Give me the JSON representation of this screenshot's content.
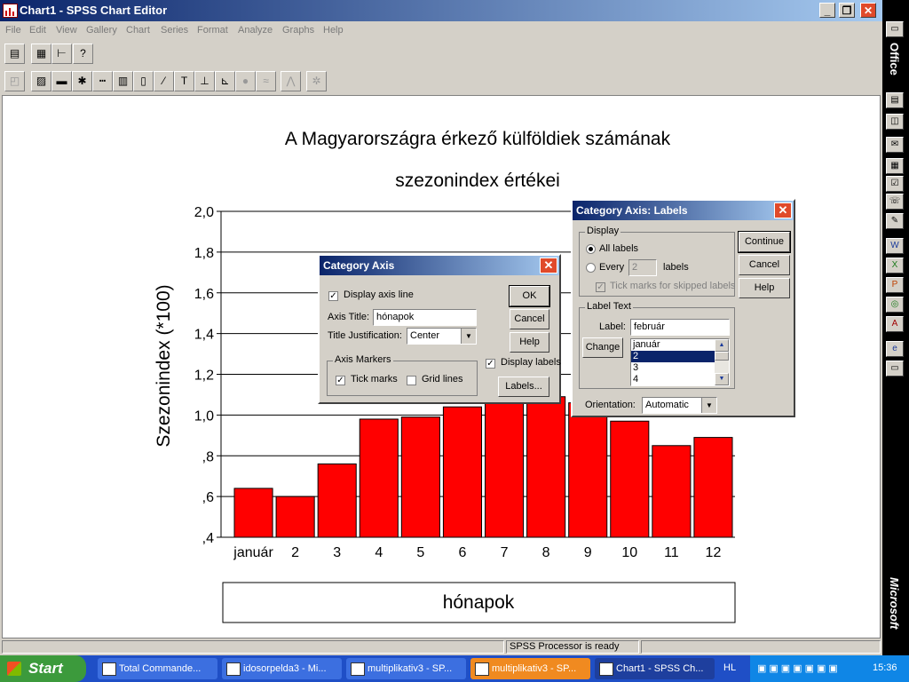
{
  "window": {
    "title": "Chart1 - SPSS Chart Editor"
  },
  "menus": [
    "File",
    "Edit",
    "View",
    "Gallery",
    "Chart",
    "Series",
    "Format",
    "Analyze",
    "Graphs",
    "Help"
  ],
  "status": {
    "message": "SPSS Processor  is ready"
  },
  "chart_data": {
    "type": "bar",
    "title": "A Magyarországra érkező külföldiek számának",
    "subtitle": "szezonindex értékei",
    "xlabel": "hónapok",
    "ylabel": "Szezonindex (*100)",
    "categories": [
      "január",
      "2",
      "3",
      "4",
      "5",
      "6",
      "7",
      "8",
      "9",
      "10",
      "11",
      "12"
    ],
    "values": [
      0.64,
      0.6,
      0.76,
      0.98,
      0.99,
      1.04,
      1.06,
      1.09,
      1.06,
      0.97,
      0.85,
      0.89
    ],
    "yticks": [
      "2,0",
      "1,8",
      "1,6",
      "1,4",
      "1,2",
      "1,0",
      ",8",
      ",6",
      ",4"
    ],
    "ylim": [
      0.4,
      2.0
    ],
    "color": "#ff0000",
    "grid": true
  },
  "dialog_axis": {
    "title": "Category Axis",
    "display_axis_line": "Display axis line",
    "axis_title_label": "Axis Title:",
    "axis_title_value": "hónapok",
    "title_just_label": "Title Justification:",
    "title_just_value": "Center",
    "axis_markers": "Axis Markers",
    "tick_marks": "Tick marks",
    "grid_lines": "Grid lines",
    "display_labels": "Display labels",
    "ok": "OK",
    "cancel": "Cancel",
    "help": "Help",
    "labels_btn": "Labels..."
  },
  "dialog_labels": {
    "title": "Category Axis: Labels",
    "display": "Display",
    "all_labels": "All labels",
    "every": "Every",
    "every_value": "2",
    "labels_suffix": "labels",
    "tick_marks_skipped": "Tick marks for skipped labels",
    "label_text": "Label Text",
    "label": "Label:",
    "label_value": "február",
    "change": "Change",
    "list": [
      "január",
      "2",
      "3",
      "4"
    ],
    "orientation_label": "Orientation:",
    "orientation_value": "Automatic",
    "continue": "Continue",
    "cancel": "Cancel",
    "help": "Help"
  },
  "office_bar": {
    "top": "Office",
    "bottom": "Microsoft"
  },
  "taskbar": {
    "start": "Start",
    "tasks": [
      "Total Commande...",
      "idosorpelda3 - Mi...",
      "multiplikativ3 - SP...",
      "multiplikativ3 - SP...",
      "Chart1 - SPSS Ch..."
    ],
    "lang": "HL",
    "clock": "15:36"
  }
}
